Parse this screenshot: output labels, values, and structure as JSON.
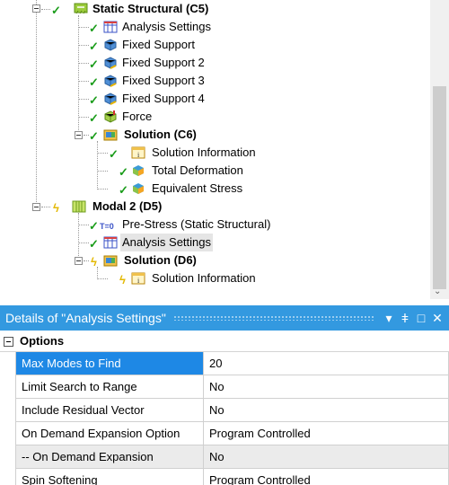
{
  "tree": {
    "nodes": [
      {
        "label": "Static Structural (C5)",
        "bold": true,
        "status": "check",
        "icon": "static-structural-icon"
      },
      {
        "label": "Analysis Settings",
        "status": "check",
        "icon": "analysis-settings-icon"
      },
      {
        "label": "Fixed Support",
        "status": "check",
        "icon": "fixed-support-icon"
      },
      {
        "label": "Fixed Support 2",
        "status": "check",
        "icon": "fixed-support-icon"
      },
      {
        "label": "Fixed Support 3",
        "status": "check",
        "icon": "fixed-support-icon"
      },
      {
        "label": "Fixed Support 4",
        "status": "check",
        "icon": "fixed-support-icon"
      },
      {
        "label": "Force",
        "status": "check",
        "icon": "force-icon"
      },
      {
        "label": "Solution (C6)",
        "bold": true,
        "status": "check",
        "icon": "solution-icon"
      },
      {
        "label": "Solution Information",
        "status": "check",
        "icon": "solution-information-icon"
      },
      {
        "label": "Total Deformation",
        "status": "check",
        "icon": "total-deformation-icon"
      },
      {
        "label": "Equivalent Stress",
        "status": "check",
        "icon": "equivalent-stress-icon"
      },
      {
        "label": "Modal 2 (D5)",
        "bold": true,
        "status": "bolt",
        "icon": "modal-icon"
      },
      {
        "label": "Pre-Stress (Static Structural)",
        "status": "check",
        "icon": "pre-stress-icon",
        "icon_text": "T=0"
      },
      {
        "label": "Analysis Settings",
        "status": "check",
        "icon": "analysis-settings-icon",
        "selected": true
      },
      {
        "label": "Solution (D6)",
        "bold": true,
        "status": "bolt",
        "icon": "solution-icon"
      },
      {
        "label": "Solution Information",
        "status": "bolt",
        "icon": "solution-information-icon"
      }
    ]
  },
  "details": {
    "title": "Details of \"Analysis Settings\"",
    "buttons": [
      "▾",
      "ǂ",
      "□",
      "✕"
    ],
    "section": "Options",
    "rows": [
      {
        "name": "Max Modes to Find",
        "value": "20",
        "selected": true
      },
      {
        "name": "Limit Search to Range",
        "value": "No"
      },
      {
        "name": "Include Residual Vector",
        "value": "No"
      },
      {
        "name": "On Demand Expansion Option",
        "value": "Program Controlled"
      },
      {
        "name": "-- On Demand Expansion",
        "value": "No",
        "grey": true
      },
      {
        "name": "Spin Softening",
        "value": "Program Controlled"
      }
    ]
  },
  "colors": {
    "titlebar": "#3399e0",
    "selected_row": "#1e88e5",
    "check": "#1a9c1a",
    "bolt": "#e3b800"
  }
}
